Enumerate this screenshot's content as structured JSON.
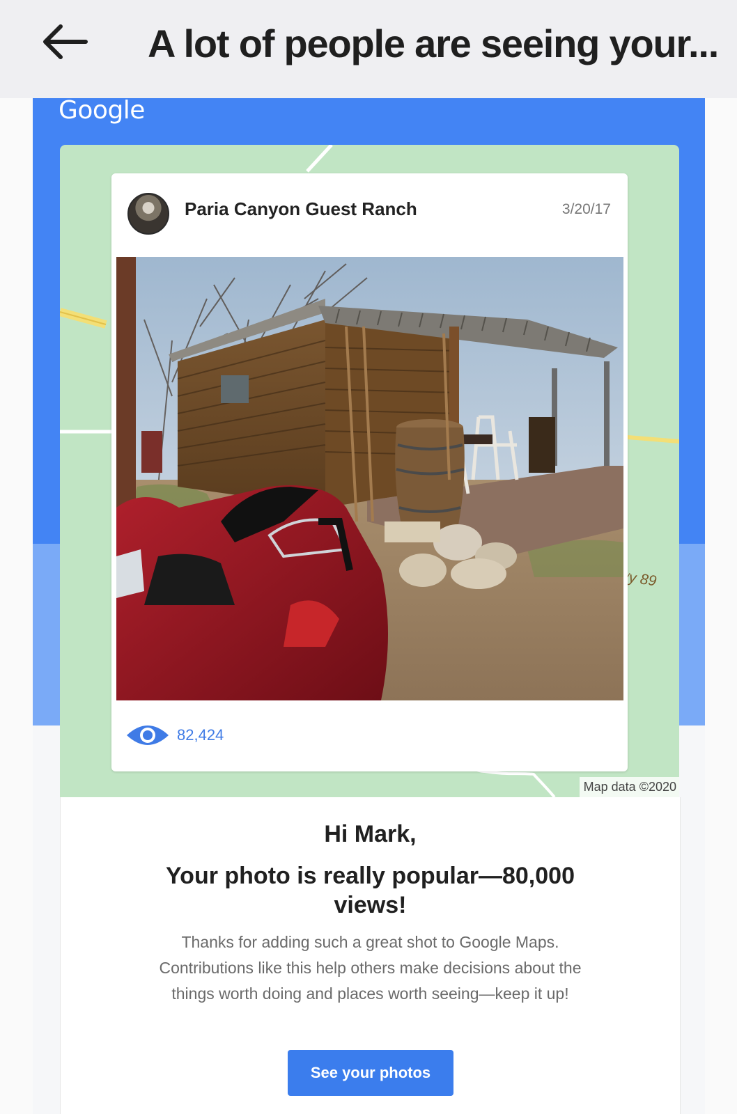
{
  "app_bar": {
    "title": "A lot of people are seeing your...",
    "back_icon": "arrow-left-icon"
  },
  "email": {
    "brand": "Google",
    "map": {
      "road_label": "ʷy 89",
      "attribution": "Map data ©2020"
    },
    "post": {
      "place_name": "Paria Canyon Guest Ranch",
      "date": "3/20/17",
      "views_icon": "eye-icon",
      "view_count": "82,424"
    },
    "message": {
      "greeting": "Hi Mark,",
      "headline": "Your photo is really popular—80,000 views!",
      "body": "Thanks for adding such a great shot to Google Maps. Contributions like this help others make decisions about the things worth doing and places worth seeing—keep it up!",
      "cta_label": "See your photos"
    }
  },
  "colors": {
    "brand_blue": "#4384f4",
    "light_blue": "#7aaaf7",
    "map_green": "#c1e5c4",
    "link_blue": "#3f7be6",
    "button_blue": "#3b7ded"
  }
}
